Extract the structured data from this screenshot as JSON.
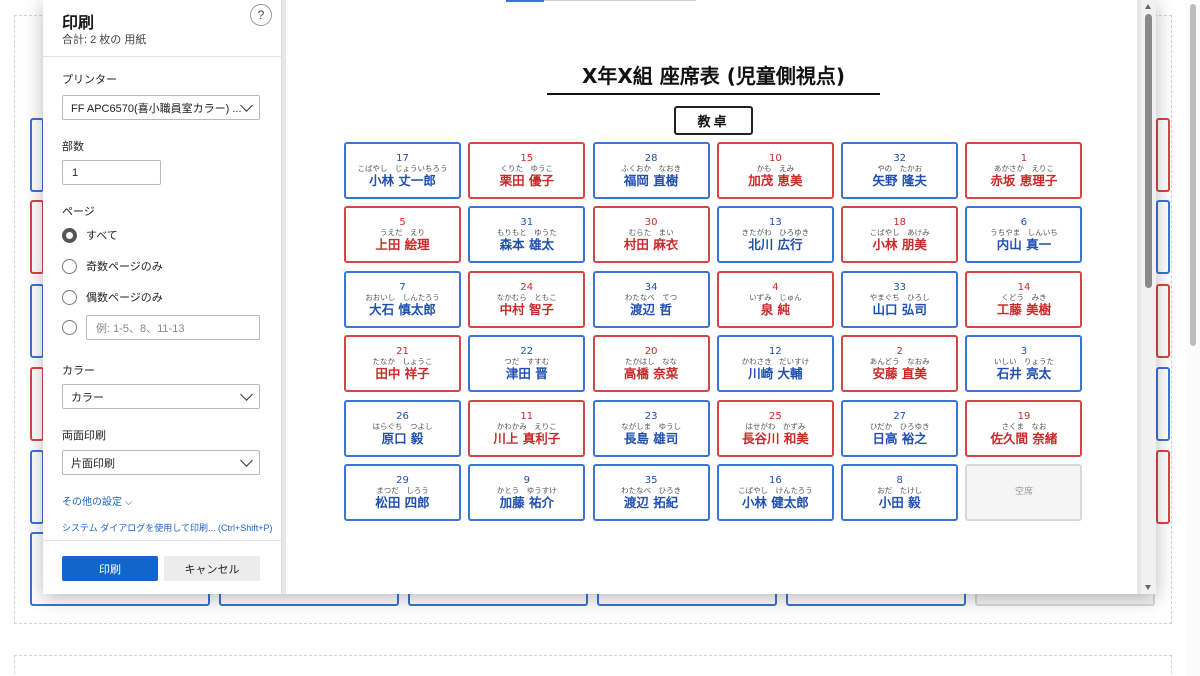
{
  "dialog": {
    "title": "印刷",
    "subtitle": "合計: 2 枚の 用紙",
    "help": "?",
    "printer_label": "プリンター",
    "printer_value": "FF APC6570(喜小職員室カラー) ...",
    "copies_label": "部数",
    "copies_value": "1",
    "pages_label": "ページ",
    "pages_options": [
      "すべて",
      "奇数ページのみ",
      "偶数ページのみ"
    ],
    "pages_range_placeholder": "例: 1-5、8、11-13",
    "color_label": "カラー",
    "color_value": "カラー",
    "duplex_label": "両面印刷",
    "duplex_value": "片面印刷",
    "more_settings": "その他の設定 ⌵",
    "system_dialog": "システム ダイアログを使用して印刷... (Ctrl+Shift+P)",
    "print_button": "印刷",
    "cancel_button": "キャンセル"
  },
  "preview": {
    "title": "X年X組 座席表 (児童側視点)",
    "teacher_desk": "教卓",
    "seats": [
      {
        "num": "17",
        "kana": "こばやし　じょういちろう",
        "name": "小林 丈一郎",
        "color": "blue"
      },
      {
        "num": "15",
        "kana": "くりた　ゆうこ",
        "name": "栗田 優子",
        "color": "red"
      },
      {
        "num": "28",
        "kana": "ふくおか　なおき",
        "name": "福岡 直樹",
        "color": "blue"
      },
      {
        "num": "10",
        "kana": "かも　えみ",
        "name": "加茂 恵美",
        "color": "red"
      },
      {
        "num": "32",
        "kana": "やの　たかお",
        "name": "矢野 隆夫",
        "color": "blue"
      },
      {
        "num": "1",
        "kana": "あかさか　えりこ",
        "name": "赤坂 恵理子",
        "color": "red"
      },
      {
        "num": "5",
        "kana": "うえだ　えり",
        "name": "上田 絵理",
        "color": "red"
      },
      {
        "num": "31",
        "kana": "もりもと　ゆうた",
        "name": "森本 雄太",
        "color": "blue"
      },
      {
        "num": "30",
        "kana": "むらた　まい",
        "name": "村田 麻衣",
        "color": "red"
      },
      {
        "num": "13",
        "kana": "きたがわ　ひろゆき",
        "name": "北川 広行",
        "color": "blue"
      },
      {
        "num": "18",
        "kana": "こばやし　あけみ",
        "name": "小林 朋美",
        "color": "red"
      },
      {
        "num": "6",
        "kana": "うちやま　しんいち",
        "name": "内山 真一",
        "color": "blue"
      },
      {
        "num": "7",
        "kana": "おおいし　しんたろう",
        "name": "大石 慎太郎",
        "color": "blue"
      },
      {
        "num": "24",
        "kana": "なかむら　ともこ",
        "name": "中村 智子",
        "color": "red"
      },
      {
        "num": "34",
        "kana": "わたなべ　てつ",
        "name": "渡辺 哲",
        "color": "blue"
      },
      {
        "num": "4",
        "kana": "いずみ　じゅん",
        "name": "泉 純",
        "color": "red"
      },
      {
        "num": "33",
        "kana": "やまぐち　ひろし",
        "name": "山口 弘司",
        "color": "blue"
      },
      {
        "num": "14",
        "kana": "くどう　みき",
        "name": "工藤 美樹",
        "color": "red"
      },
      {
        "num": "21",
        "kana": "たなか　しょうこ",
        "name": "田中 祥子",
        "color": "red"
      },
      {
        "num": "22",
        "kana": "つだ　すすむ",
        "name": "津田 晋",
        "color": "blue"
      },
      {
        "num": "20",
        "kana": "たかはし　なな",
        "name": "高橋 奈菜",
        "color": "red"
      },
      {
        "num": "12",
        "kana": "かわさき　だいすけ",
        "name": "川崎 大輔",
        "color": "blue"
      },
      {
        "num": "2",
        "kana": "あんどう　なおみ",
        "name": "安藤 直美",
        "color": "red"
      },
      {
        "num": "3",
        "kana": "いしい　りょうた",
        "name": "石井 亮太",
        "color": "blue"
      },
      {
        "num": "26",
        "kana": "はらぐち　つよし",
        "name": "原口 毅",
        "color": "blue"
      },
      {
        "num": "11",
        "kana": "かわかみ　えりこ",
        "name": "川上 真利子",
        "color": "red"
      },
      {
        "num": "23",
        "kana": "ながしま　ゆうし",
        "name": "長島 雄司",
        "color": "blue"
      },
      {
        "num": "25",
        "kana": "はせがわ　かずみ",
        "name": "長谷川 和美",
        "color": "red"
      },
      {
        "num": "27",
        "kana": "ひだか　ひろゆき",
        "name": "日高 裕之",
        "color": "blue"
      },
      {
        "num": "19",
        "kana": "さくま　なお",
        "name": "佐久間 奈緒",
        "color": "red"
      },
      {
        "num": "29",
        "kana": "まつだ　しろう",
        "name": "松田 四郎",
        "color": "blue"
      },
      {
        "num": "9",
        "kana": "かとう　ゆうすけ",
        "name": "加藤 祐介",
        "color": "blue"
      },
      {
        "num": "35",
        "kana": "わたなべ　ひろき",
        "name": "渡辺 拓紀",
        "color": "blue"
      },
      {
        "num": "16",
        "kana": "こばやし　けんたろう",
        "name": "小林 健太郎",
        "color": "blue"
      },
      {
        "num": "8",
        "kana": "おだ　たけし",
        "name": "小田 毅",
        "color": "blue"
      },
      {
        "num": "",
        "kana": "",
        "name": "空席",
        "color": "empty"
      }
    ]
  },
  "colors": {
    "blue": "#3b74d6",
    "red": "#d64545",
    "primary": "#1166cc"
  }
}
